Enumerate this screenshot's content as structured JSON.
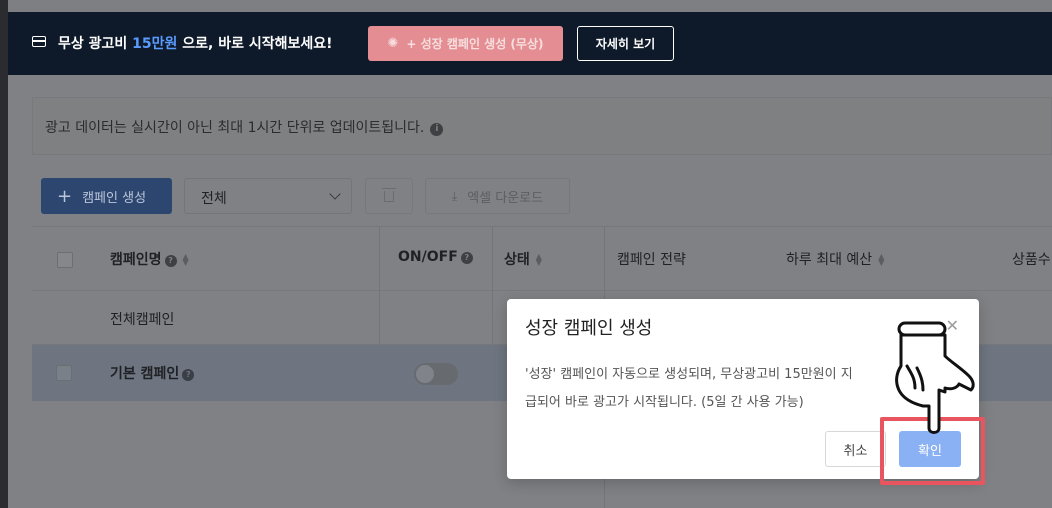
{
  "banner": {
    "text_prefix": "무상 광고비 ",
    "text_highlight": "15만원",
    "text_suffix": " 으로, 바로 시작해보세요!",
    "create_button": "+ 성장 캠페인 생성 (무상)",
    "detail_button": "자세히 보기",
    "icon": "card-icon"
  },
  "notice": {
    "text": "광고 데이터는 실시간이 아닌 최대 1시간 단위로 업데이트됩니다.",
    "icon": "info-icon"
  },
  "toolbar": {
    "create_campaign": "캠페인 생성",
    "filter_value": "전체",
    "excel_download": "엑셀 다운로드"
  },
  "table": {
    "headers": {
      "campaign_name": "캠페인명",
      "on_off": "ON/OFF",
      "status": "상태",
      "strategy": "캠페인 전략",
      "daily_budget": "하루 최대 예산",
      "products": "상품수"
    },
    "rows": [
      {
        "name": "전체캠페인"
      },
      {
        "name": "기본 캠페인"
      }
    ]
  },
  "modal": {
    "title": "성장 캠페인 생성",
    "body_line1": "'성장' 캠페인이 자동으로 생성되며, 무상광고비 15만원이 지",
    "body_line2": "급되어 바로 광고가 시작됩니다. (5일 간 사용 가능)",
    "cancel": "취소",
    "confirm": "확인"
  },
  "colors": {
    "banner_bg": "#0e1a2a",
    "highlight_blue": "#5a9bff",
    "primary_button": "#8ab1f3",
    "annotation_red": "#e8555f"
  }
}
